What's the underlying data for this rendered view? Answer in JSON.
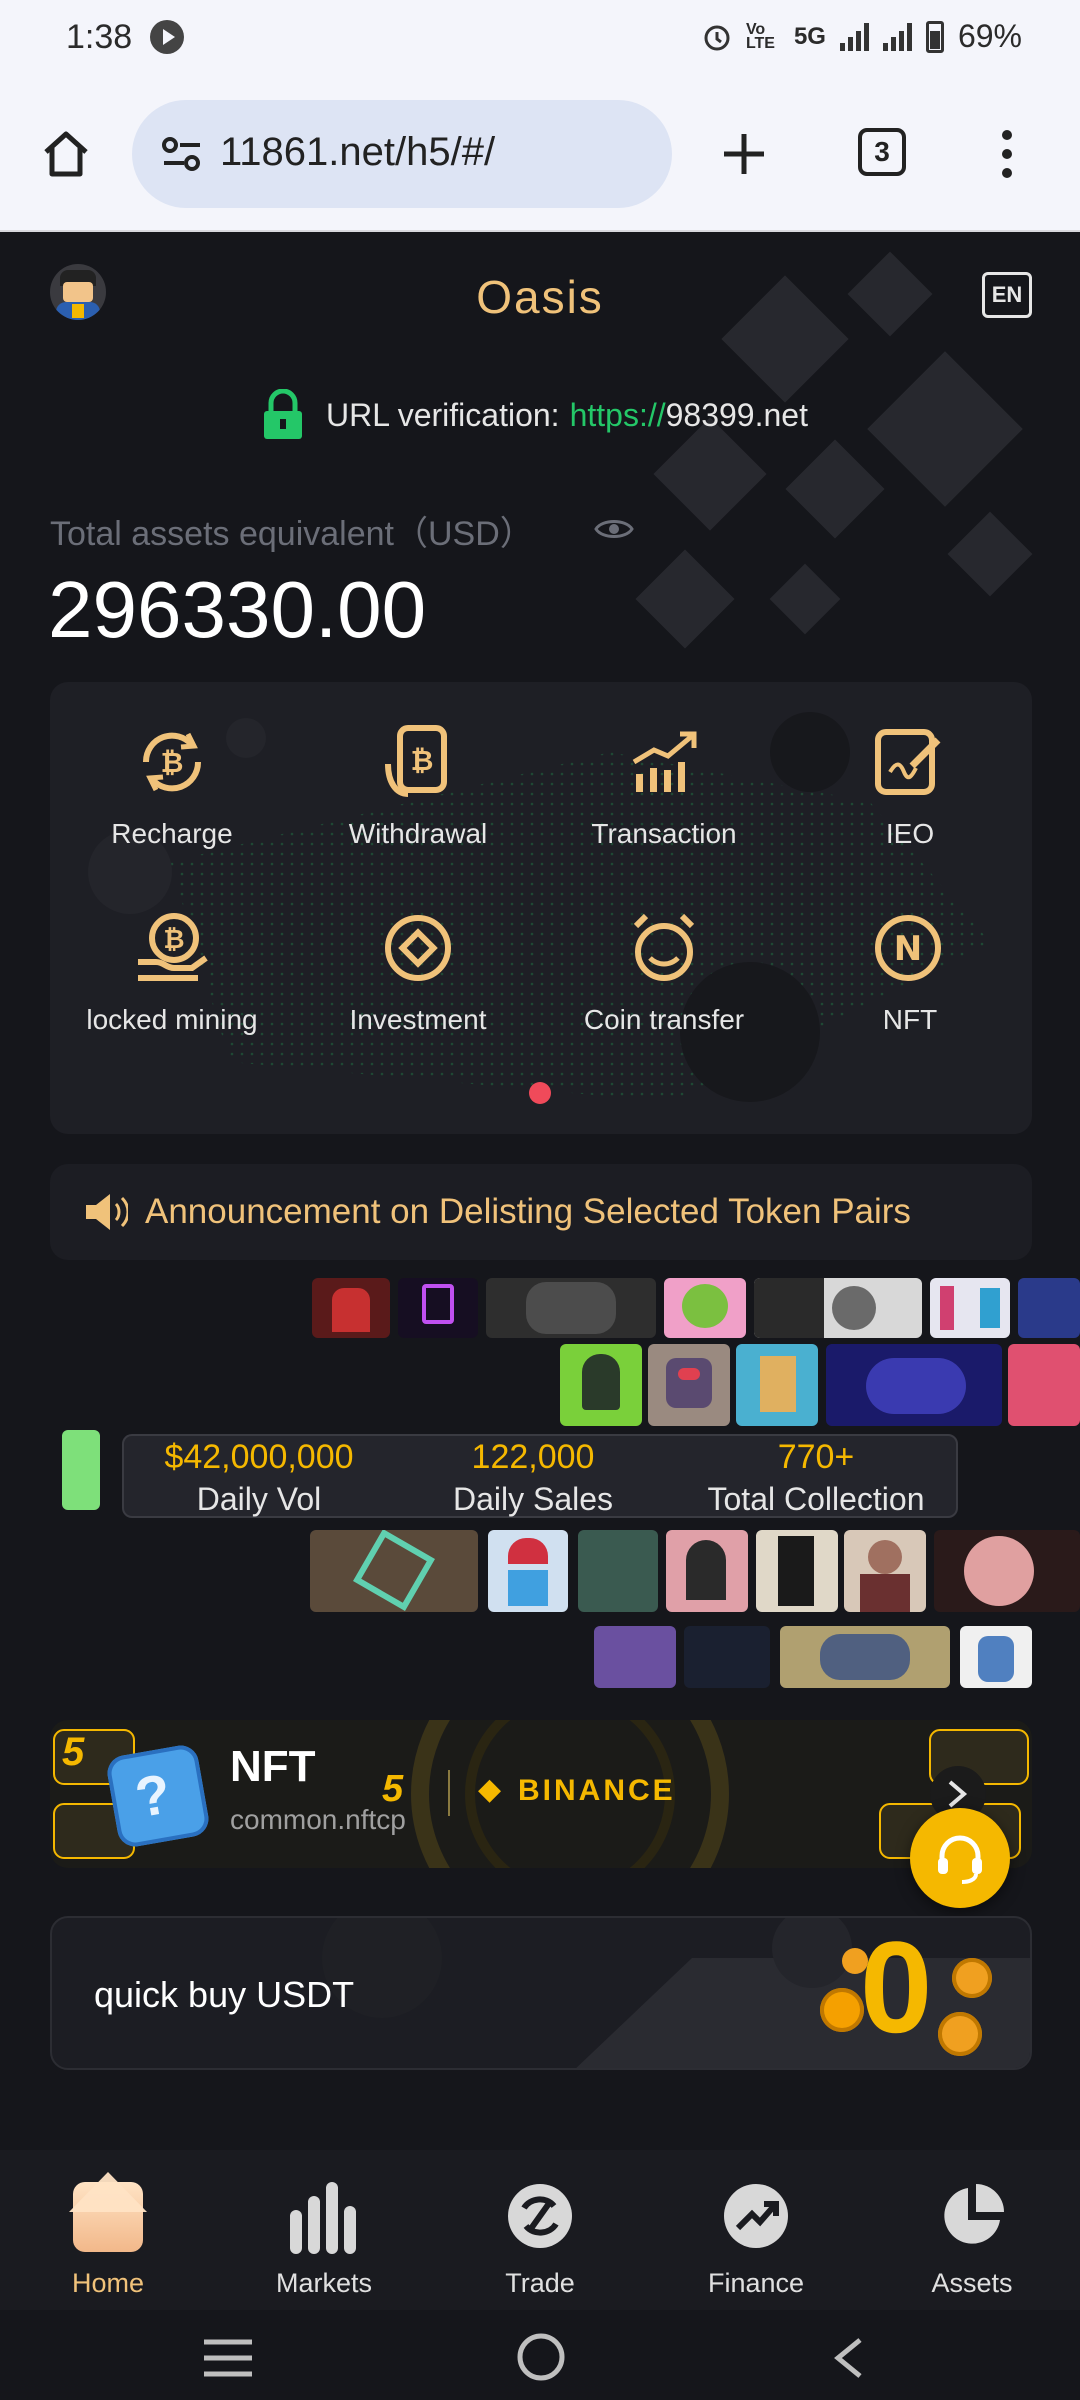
{
  "status_bar": {
    "time": "1:38",
    "network": "5G",
    "volte": "Vo LTE",
    "battery": "69%"
  },
  "browser": {
    "url": "11861.net/h5/#/",
    "tab_count": "3"
  },
  "header": {
    "title": "Oasis",
    "lang_badge": "EN"
  },
  "verification": {
    "label": "URL verification:",
    "scheme": "https://",
    "domain": "98399.net"
  },
  "assets": {
    "label": "Total assets equivalent（USD）",
    "value": "296330.00"
  },
  "quick_menu": {
    "items": [
      {
        "label": "Recharge",
        "icon": "bitcoin-refresh-icon"
      },
      {
        "label": "Withdrawal",
        "icon": "bitcoin-phone-icon"
      },
      {
        "label": "Transaction",
        "icon": "trend-chart-icon"
      },
      {
        "label": "IEO",
        "icon": "edit-document-icon"
      },
      {
        "label": "locked mining",
        "icon": "bitcoin-hand-icon"
      },
      {
        "label": "Investment",
        "icon": "target-icon"
      },
      {
        "label": "Coin transfer",
        "icon": "clock-transfer-icon"
      },
      {
        "label": "NFT",
        "icon": "nft-icon"
      }
    ]
  },
  "announcement": {
    "text": "Announcement on Delisting Selected Token Pairs"
  },
  "nft_stats": [
    {
      "value": "$42,000,000",
      "label": "Daily Vol"
    },
    {
      "value": "122,000",
      "label": "Daily Sales"
    },
    {
      "value": "770+",
      "label": "Total Collection"
    }
  ],
  "nft_banner": {
    "title": "NFT",
    "subtitle": "common.nftcp",
    "partner": "BINANCE",
    "badge": "5"
  },
  "quick_buy": {
    "label": "quick buy USDT",
    "badge": "0"
  },
  "bottom_nav": [
    {
      "label": "Home",
      "active": true
    },
    {
      "label": "Markets",
      "active": false
    },
    {
      "label": "Trade",
      "active": false
    },
    {
      "label": "Finance",
      "active": false
    },
    {
      "label": "Assets",
      "active": false
    }
  ],
  "colors": {
    "accent": "#f0c27a",
    "gold": "#f5b800",
    "green": "#24c768",
    "text": "#e6e6e6",
    "muted": "#6b6e78"
  }
}
